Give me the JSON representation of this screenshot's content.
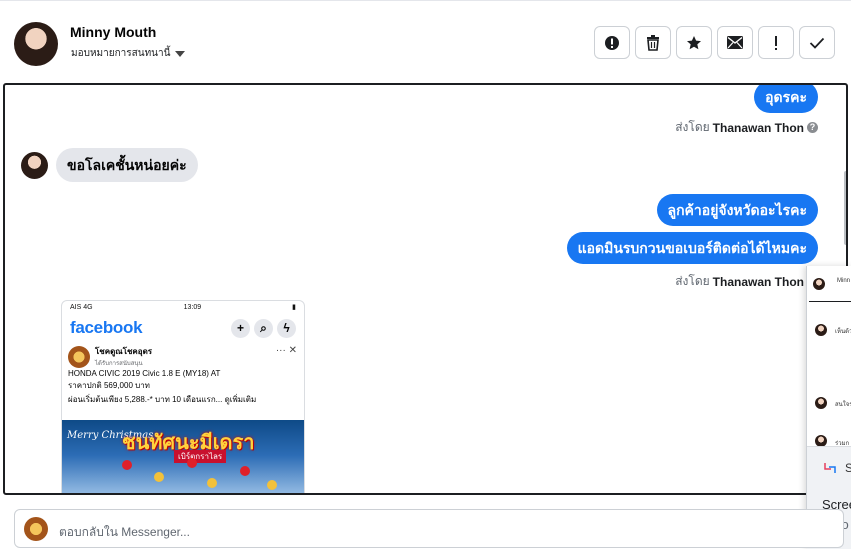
{
  "header": {
    "contact_name": "Minny Mouth",
    "assign_label": "มอบหมายการสนทนานี้",
    "toolbar": [
      {
        "id": "spam",
        "icon": "alert-circle-icon"
      },
      {
        "id": "delete",
        "icon": "trash-icon"
      },
      {
        "id": "star",
        "icon": "star-icon"
      },
      {
        "id": "unread",
        "icon": "envelope-icon"
      },
      {
        "id": "follow_up",
        "icon": "exclamation-icon"
      },
      {
        "id": "done",
        "icon": "checkmark-icon"
      }
    ]
  },
  "thread": {
    "messages": [
      {
        "direction": "out",
        "text": "อุดรคะ"
      },
      {
        "direction": "meta",
        "prefix": "ส่งโดย",
        "sender": "Thanawan Thon"
      },
      {
        "direction": "in",
        "text": "ขอโลเคชั้นหน่อยค่ะ"
      },
      {
        "direction": "out",
        "text": "ลูกค้าอยู่จังหวัดอะไรคะ"
      },
      {
        "direction": "out",
        "text": "แอดมินรบกวนขอเบอร์ติดต่อได้ไหมคะ"
      },
      {
        "direction": "meta",
        "prefix": "ส่งโดย",
        "sender": "Thanawan Thon"
      }
    ],
    "screenshot": {
      "status_carrier": "AIS 4G",
      "status_time": "13:09",
      "app_logo": "facebook",
      "page_name": "โชคดูณโชคอุดร",
      "page_sub": "ได้รับการสนับสนุน",
      "lines": [
        "HONDA CIVIC 2019 Civic 1.8 E (MY18) AT",
        "ราคาปกติ 569,000 บาท",
        "ผ่อนเริ่มต้นเพียง 5,288.-* บาท 10 เดือนแรก... ดูเพิ่มเติม"
      ],
      "banner_title": "ชนทัศนะมีเดรา",
      "banner_sub": "เบิร์ตกราไลร"
    }
  },
  "side_panel": {
    "items": [
      "Minn",
      "เห็นด้วย",
      "สนใจร",
      "ร่วมก"
    ],
    "card_title": "S",
    "card_lines": [
      "Scree",
      "Auto"
    ]
  },
  "reply": {
    "placeholder": "ตอบกลับใน Messenger..."
  }
}
